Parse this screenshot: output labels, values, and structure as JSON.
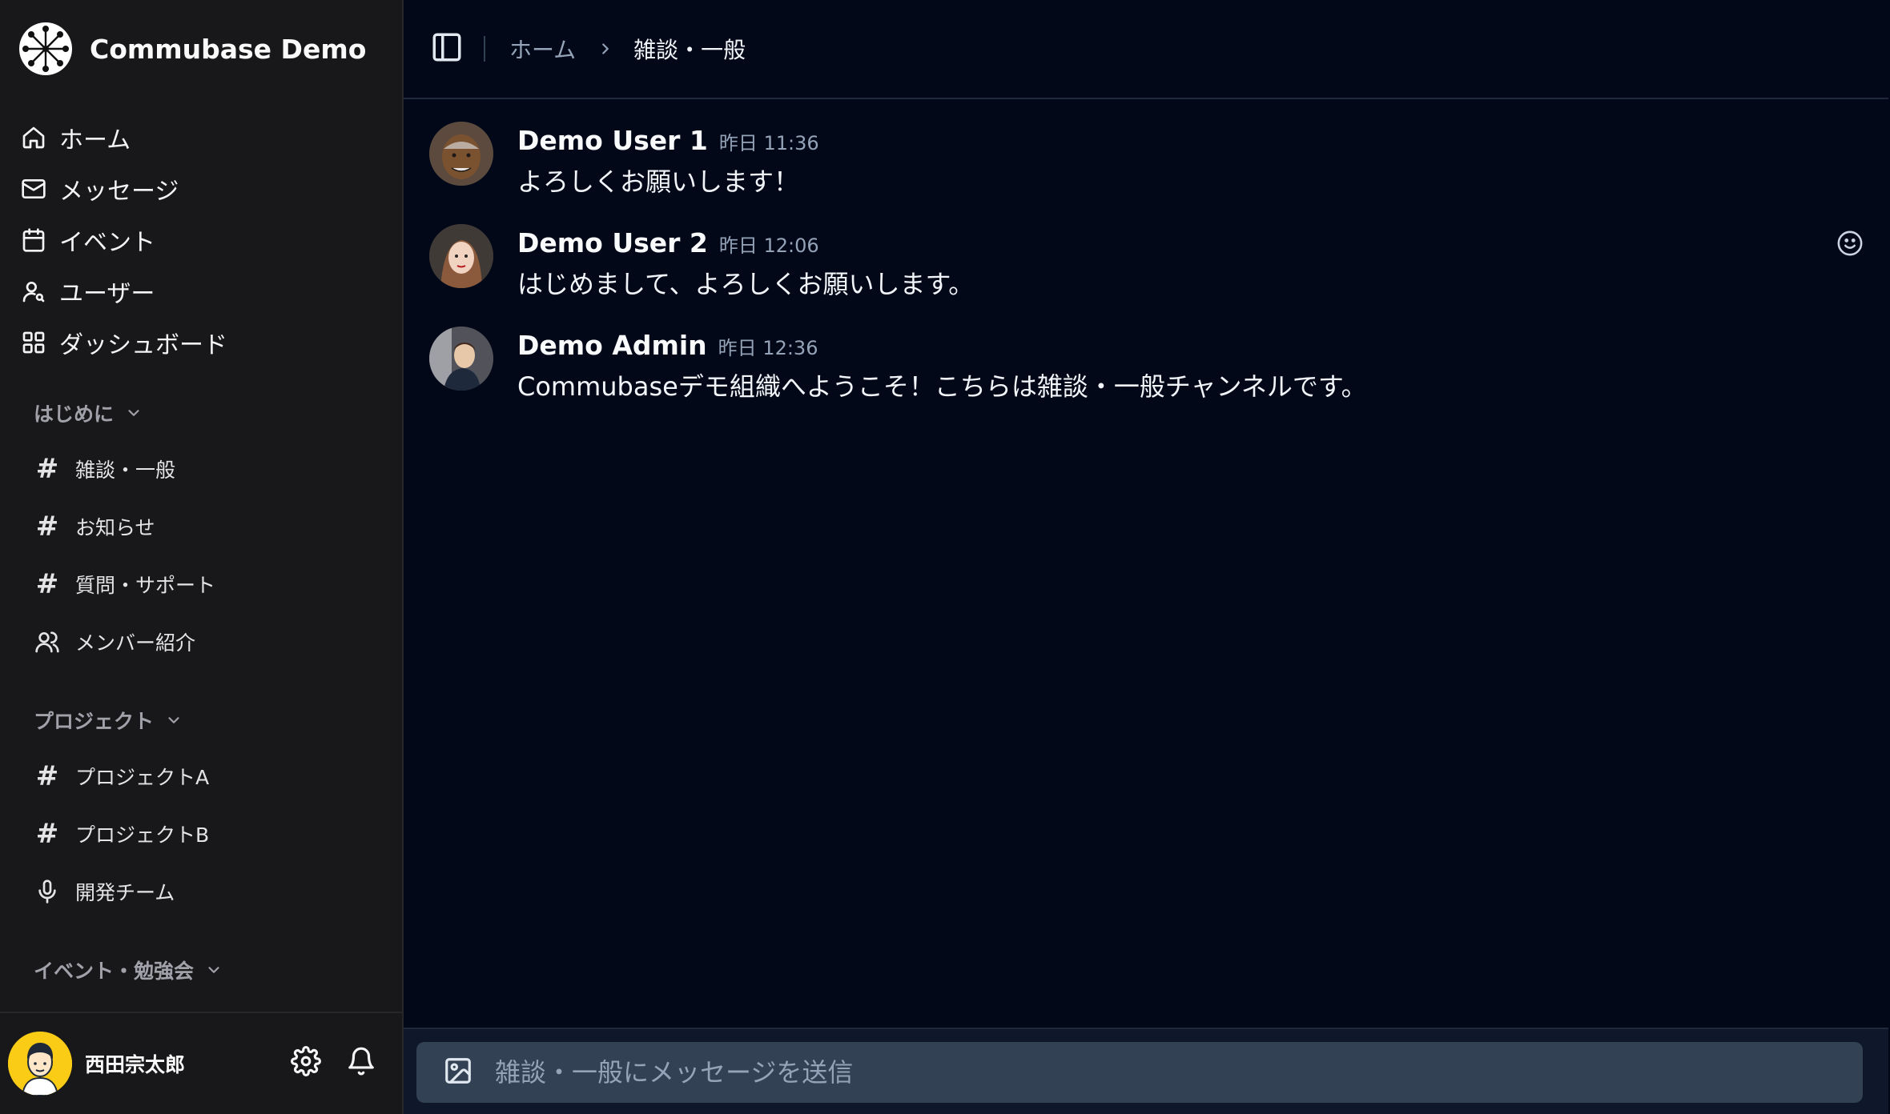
{
  "brand": {
    "name": "Commubase Demo"
  },
  "main_nav": [
    {
      "label": "ホーム",
      "icon": "home-icon"
    },
    {
      "label": "メッセージ",
      "icon": "mail-icon"
    },
    {
      "label": "イベント",
      "icon": "calendar-icon"
    },
    {
      "label": "ユーザー",
      "icon": "user-search-icon"
    },
    {
      "label": "ダッシュボード",
      "icon": "dashboard-grid-icon"
    }
  ],
  "sections": [
    {
      "title": "はじめに",
      "channels": [
        {
          "label": "雑談・一般",
          "icon": "hash-icon"
        },
        {
          "label": "お知らせ",
          "icon": "hash-icon"
        },
        {
          "label": "質問・サポート",
          "icon": "hash-icon"
        },
        {
          "label": "メンバー紹介",
          "icon": "users-icon"
        }
      ]
    },
    {
      "title": "プロジェクト",
      "channels": [
        {
          "label": "プロジェクトA",
          "icon": "hash-icon"
        },
        {
          "label": "プロジェクトB",
          "icon": "hash-icon"
        },
        {
          "label": "開発チーム",
          "icon": "microphone-icon"
        }
      ]
    },
    {
      "title": "イベント・勉強会",
      "channels": []
    }
  ],
  "current_user": {
    "name": "西田宗太郎"
  },
  "breadcrumb": {
    "home": "ホーム",
    "current": "雑談・一般"
  },
  "messages": [
    {
      "author": "Demo User 1",
      "time": "昨日 11:36",
      "text": "よろしくお願いします！"
    },
    {
      "author": "Demo User 2",
      "time": "昨日 12:06",
      "text": "はじめまして、よろしくお願いします。"
    },
    {
      "author": "Demo Admin",
      "time": "昨日 12:36",
      "text": "Commubaseデモ組織へようこそ！こちらは雑談・一般チャンネルです。"
    }
  ],
  "composer": {
    "placeholder": "雑談・一般にメッセージを送信",
    "value": ""
  },
  "colors": {
    "sidebar_bg": "#18181b",
    "main_bg": "#020817",
    "composer_bg": "#334155",
    "avatar_yellow": "#facc15"
  }
}
